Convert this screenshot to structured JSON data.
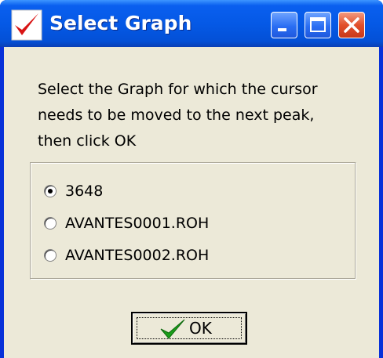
{
  "window": {
    "title": "Select Graph",
    "app_icon": "red-checkmark-icon"
  },
  "titlebar_buttons": {
    "minimize": "minimize-icon",
    "maximize": "maximize-icon",
    "close": "close-icon"
  },
  "prompt": {
    "lines": [
      "Select the Graph for which the cursor",
      "needs to be moved to the next peak,",
      "then click OK"
    ]
  },
  "options": [
    {
      "label": "3648",
      "selected": true
    },
    {
      "label": "AVANTES0001.ROH",
      "selected": false
    },
    {
      "label": "AVANTES0002.ROH",
      "selected": false
    }
  ],
  "ok_button": {
    "label": "OK",
    "icon": "green-checkmark-icon"
  },
  "colors": {
    "titlebar": "#0559e6",
    "dialog_bg": "#ece9d8",
    "close_button": "#e2502b",
    "ok_check": "#1a9e1a",
    "app_icon_red": "#d81414"
  }
}
